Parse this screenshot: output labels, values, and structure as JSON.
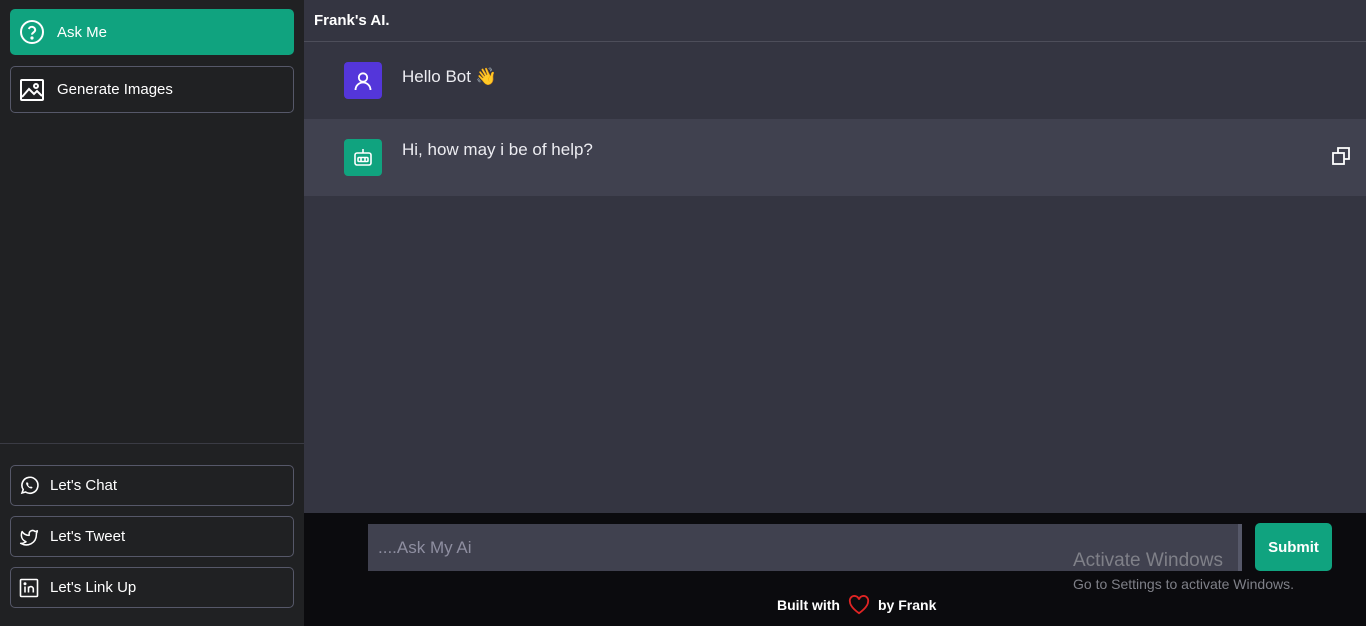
{
  "sidebar": {
    "ask_label": "Ask Me",
    "generate_label": "Generate Images",
    "chat_label": "Let's Chat",
    "tweet_label": "Let's Tweet",
    "link_label": "Let's Link Up"
  },
  "header": {
    "title": "Frank's AI."
  },
  "messages": [
    {
      "role": "user",
      "text": "Hello Bot 👋",
      "avatar_icon": "user-icon"
    },
    {
      "role": "bot",
      "text": "Hi, how may i be of help?",
      "avatar_icon": "robot-icon"
    }
  ],
  "input": {
    "placeholder": "....Ask My Ai",
    "value": ""
  },
  "submit_label": "Submit",
  "footer": {
    "built_with": "Built with",
    "by": "by Frank"
  },
  "watermark": {
    "title": "Activate Windows",
    "subtitle": "Go to Settings to activate Windows."
  },
  "colors": {
    "accent": "#10a37f",
    "user_avatar": "#5436da",
    "sidebar_bg": "#202123",
    "main_bg": "#343541",
    "bot_row_bg": "#40414f",
    "heart": "#e02424"
  }
}
